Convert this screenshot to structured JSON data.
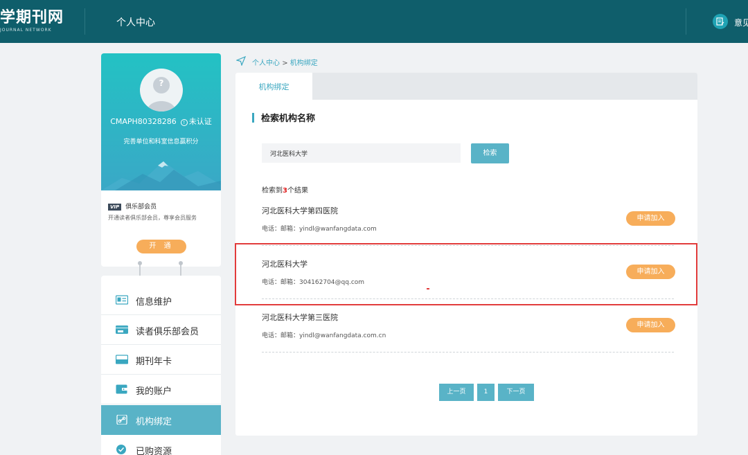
{
  "header": {
    "logo_text": "学期刊网",
    "logo_sub": "JOURNAL NETWORK",
    "page_title": "个人中心",
    "feedback_label": "意见"
  },
  "profile": {
    "avatar_char": "?",
    "username": "CMAPH80328286",
    "verify_icon": "!",
    "verify_status": "未认证",
    "hint": "完善单位和科室信息赢积分",
    "vip_badge": "VIP",
    "vip_title": "俱乐部会员",
    "vip_desc": "开通读者俱乐部会员，尊享会员服务",
    "open_label": "开 通"
  },
  "menu": {
    "items": [
      {
        "label": "信息维护",
        "icon": "id-card-icon"
      },
      {
        "label": "读者俱乐部会员",
        "icon": "vip-card-icon"
      },
      {
        "label": "期刊年卡",
        "icon": "card-icon"
      },
      {
        "label": "我的账户",
        "icon": "wallet-icon"
      },
      {
        "label": "机构绑定",
        "icon": "link-icon",
        "active": true
      },
      {
        "label": "已购资源",
        "icon": "check-circle-icon"
      }
    ]
  },
  "breadcrumb": {
    "home": "个人中心",
    "separator": ">",
    "current": "机构绑定"
  },
  "main": {
    "tab_label": "机构绑定",
    "section_title": "检索机构名称",
    "search": {
      "value": "河北医科大学",
      "button_label": "检索"
    },
    "result_count": {
      "prefix": "检索到",
      "count": "3",
      "suffix": "个结果"
    },
    "results": [
      {
        "name": "河北医科大学第四医院",
        "contact": "电话：邮箱：yindl@wanfangdata.com",
        "apply_label": "申请加入"
      },
      {
        "name": "河北医科大学",
        "contact": "电话：邮箱：304162704@qq.com",
        "apply_label": "申请加入"
      },
      {
        "name": "河北医科大学第三医院",
        "contact": "电话：邮箱：yindl@wanfangdata.com.cn",
        "apply_label": "申请加入"
      }
    ],
    "pager": {
      "prev": "上一页",
      "page": "1",
      "next": "下一页"
    }
  },
  "colors": {
    "header_bg": "#0f5e6b",
    "accent": "#59b3c7",
    "orange": "#f7ad5a",
    "highlight": "#e23b3b"
  }
}
